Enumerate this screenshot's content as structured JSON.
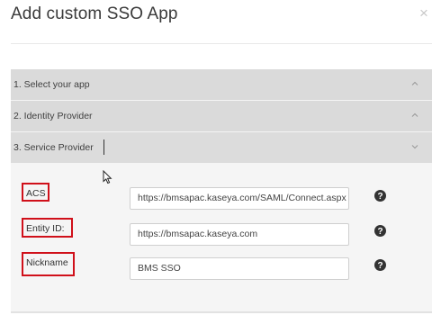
{
  "dialog": {
    "title": "Add custom SSO App",
    "close_icon": "close-icon"
  },
  "accordion": {
    "sections": [
      {
        "label": "1. Select your app",
        "state": "collapsed",
        "chevron": "chevron-up-icon"
      },
      {
        "label": "2. Identity Provider",
        "state": "collapsed",
        "chevron": "chevron-up-icon"
      },
      {
        "label": "3. Service Provider",
        "state": "expanded",
        "chevron": "chevron-down-icon"
      }
    ]
  },
  "service_provider": {
    "fields": [
      {
        "label": "ACS",
        "value": "https://bmsapac.kaseya.com/SAML/Connect.aspx",
        "help_icon": "help-icon"
      },
      {
        "label": "Entity ID:",
        "value": "https://bmsapac.kaseya.com",
        "help_icon": "help-icon"
      },
      {
        "label": "Nickname",
        "value": "BMS SSO",
        "help_icon": "help-icon"
      }
    ]
  },
  "colors": {
    "highlight_border": "#d0101a",
    "section_header_bg": "#dadada",
    "panel_bg": "#f4f4f4"
  }
}
